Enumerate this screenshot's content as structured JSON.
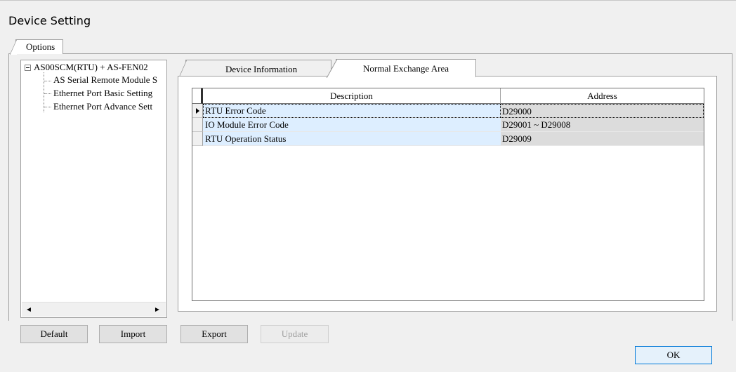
{
  "window": {
    "title": "Device Setting"
  },
  "outer_tabs": [
    {
      "label": "Options"
    }
  ],
  "tree": {
    "root": "AS00SCM(RTU) + AS-FEN02",
    "children": [
      {
        "label": "AS Serial Remote Module S"
      },
      {
        "label": "Ethernet Port Basic Setting"
      },
      {
        "label": "Ethernet Port Advance Sett"
      }
    ],
    "scroll_left_icon": "◄",
    "scroll_right_icon": "►"
  },
  "inner_tabs": [
    {
      "label": "Device Information",
      "selected": false
    },
    {
      "label": "Normal Exchange Area",
      "selected": true
    }
  ],
  "grid": {
    "columns": [
      "Description",
      "Address"
    ],
    "rows": [
      {
        "description": "RTU Error Code",
        "address": "D29000"
      },
      {
        "description": "IO Module Error Code",
        "address": "D29001 ~ D29008"
      },
      {
        "description": "RTU Operation Status",
        "address": "D29009"
      }
    ]
  },
  "buttons": {
    "default": "Default",
    "import": "Import",
    "export": "Export",
    "update": "Update",
    "ok": "OK"
  }
}
